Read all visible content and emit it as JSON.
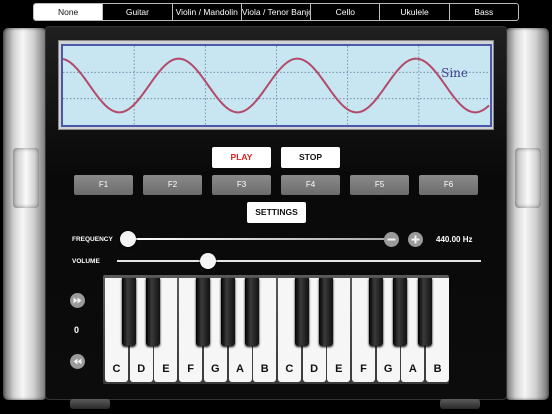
{
  "tabs": [
    {
      "label": "None",
      "active": true
    },
    {
      "label": "Guitar",
      "active": false
    },
    {
      "label": "Violin / Mandolin",
      "active": false
    },
    {
      "label": "Viola / Tenor Banjo",
      "active": false
    },
    {
      "label": "Cello",
      "active": false
    },
    {
      "label": "Ukulele",
      "active": false
    },
    {
      "label": "Bass",
      "active": false
    }
  ],
  "scope": {
    "waveform": "Sine",
    "cycles_shown": 3.6,
    "wave_color": "#b34a6a",
    "grid_color": "#6a7aa0"
  },
  "controls": {
    "play_label": "PLAY",
    "stop_label": "STOP",
    "settings_label": "SETTINGS",
    "function_keys": [
      "F1",
      "F2",
      "F3",
      "F4",
      "F5",
      "F6"
    ]
  },
  "frequency": {
    "label": "FREQUENCY",
    "value_text": "440.00 Hz",
    "slider_fraction": 0.0
  },
  "volume": {
    "label": "VOLUME",
    "slider_fraction": 0.25
  },
  "octave": {
    "value": "0",
    "up_icon": "fast-forward-icon",
    "down_icon": "rewind-icon"
  },
  "keyboard": {
    "white_keys": [
      "C",
      "D",
      "E",
      "F",
      "G",
      "A",
      "B",
      "C",
      "D",
      "E",
      "F",
      "G",
      "A",
      "B"
    ],
    "black_keys_after_white": [
      0,
      1,
      3,
      4,
      5,
      7,
      8,
      10,
      11,
      12
    ]
  },
  "colors": {
    "play": "#e02222",
    "scope_background": "#c7e6f1",
    "scope_border": "#4b58a8"
  }
}
